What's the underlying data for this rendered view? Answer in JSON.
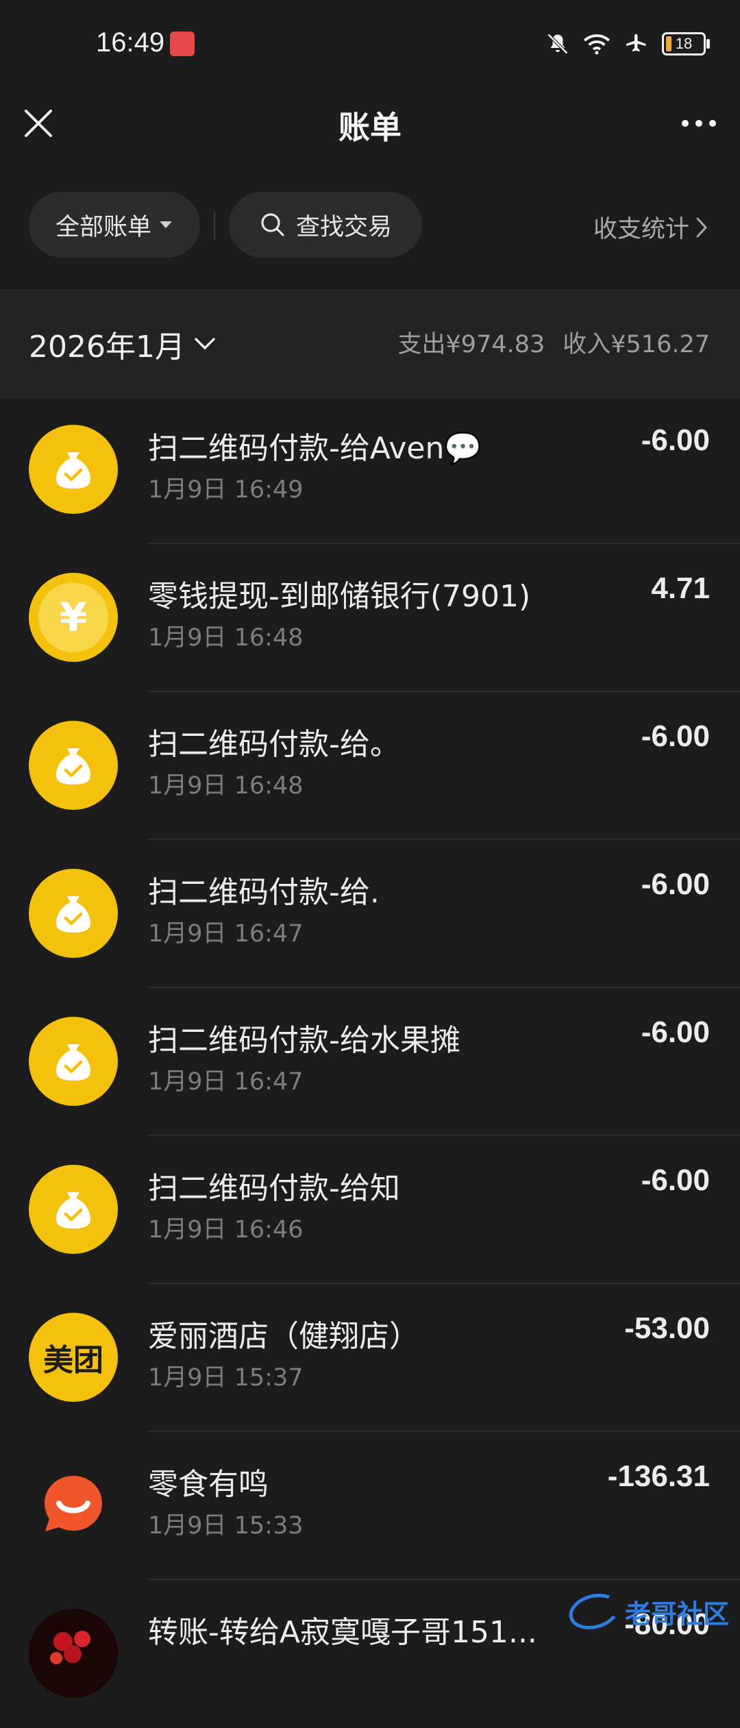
{
  "status_bar": {
    "time": "16:49",
    "battery": "18"
  },
  "nav": {
    "title": "账单"
  },
  "filters": {
    "all_bills": "全部账单",
    "search": "查找交易",
    "stats": "收支统计"
  },
  "month": {
    "label": "2026年1月",
    "expense": "支出¥974.83",
    "income": "收入¥516.27"
  },
  "transactions": [
    {
      "title": "扫二维码付款-给Aven💬",
      "time": "1月9日 16:49",
      "amount": "-6.00",
      "icon": "money-bag-check-icon"
    },
    {
      "title": "零钱提现-到邮储银行(7901)",
      "time": "1月9日 16:48",
      "amount": "4.71",
      "icon": "yuan-coin-icon"
    },
    {
      "title": "扫二维码付款-给。",
      "time": "1月9日 16:48",
      "amount": "-6.00",
      "icon": "money-bag-check-icon"
    },
    {
      "title": "扫二维码付款-给.",
      "time": "1月9日 16:47",
      "amount": "-6.00",
      "icon": "money-bag-check-icon"
    },
    {
      "title": "扫二维码付款-给水果摊",
      "time": "1月9日 16:47",
      "amount": "-6.00",
      "icon": "money-bag-check-icon"
    },
    {
      "title": "扫二维码付款-给知",
      "time": "1月9日 16:46",
      "amount": "-6.00",
      "icon": "money-bag-check-icon"
    },
    {
      "title": "爱丽酒店（健翔店）",
      "time": "1月9日 15:37",
      "amount": "-53.00",
      "icon": "meituan-logo",
      "logo_text": "美团"
    },
    {
      "title": "零食有鸣",
      "time": "1月9日 15:33",
      "amount": "-136.31",
      "icon": "smile-chat-icon"
    },
    {
      "title": "转账-转给A寂寞嘎子哥151...",
      "time": "",
      "amount": "-80.00",
      "icon": "avatar"
    }
  ],
  "watermark": {
    "text": "老哥社区"
  },
  "colors": {
    "background": "#1c1c1c",
    "accent_yellow": "#f4c20d",
    "snack_orange": "#f0562a"
  }
}
